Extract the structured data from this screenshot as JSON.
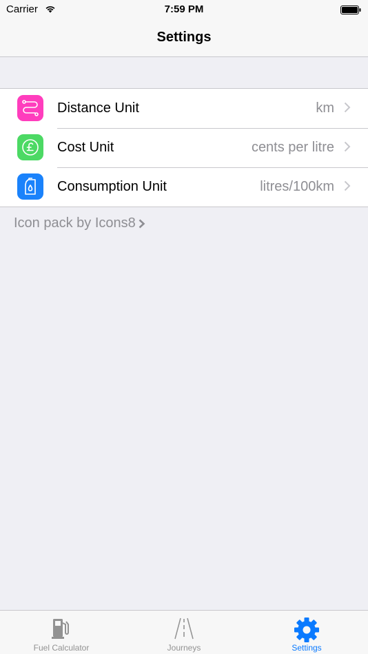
{
  "status_bar": {
    "carrier": "Carrier",
    "time": "7:59 PM"
  },
  "nav": {
    "title": "Settings"
  },
  "settings": {
    "items": [
      {
        "label": "Distance Unit",
        "value": "km",
        "icon": "route-icon",
        "color": "#ff3dbd"
      },
      {
        "label": "Cost Unit",
        "value": "cents per litre",
        "icon": "pound-coin-icon",
        "color": "#4cd964"
      },
      {
        "label": "Consumption Unit",
        "value": "litres/100km",
        "icon": "fuel-can-icon",
        "color": "#1a82fb"
      }
    ]
  },
  "footer": {
    "link_text": "Icon pack by Icons8"
  },
  "tabs": [
    {
      "label": "Fuel Calculator",
      "icon": "fuel-pump-icon",
      "active": false
    },
    {
      "label": "Journeys",
      "icon": "road-icon",
      "active": false
    },
    {
      "label": "Settings",
      "icon": "gear-icon",
      "active": true
    }
  ],
  "colors": {
    "accent": "#0a7aff",
    "background": "#efeff4",
    "secondary_text": "#8e8e93"
  }
}
